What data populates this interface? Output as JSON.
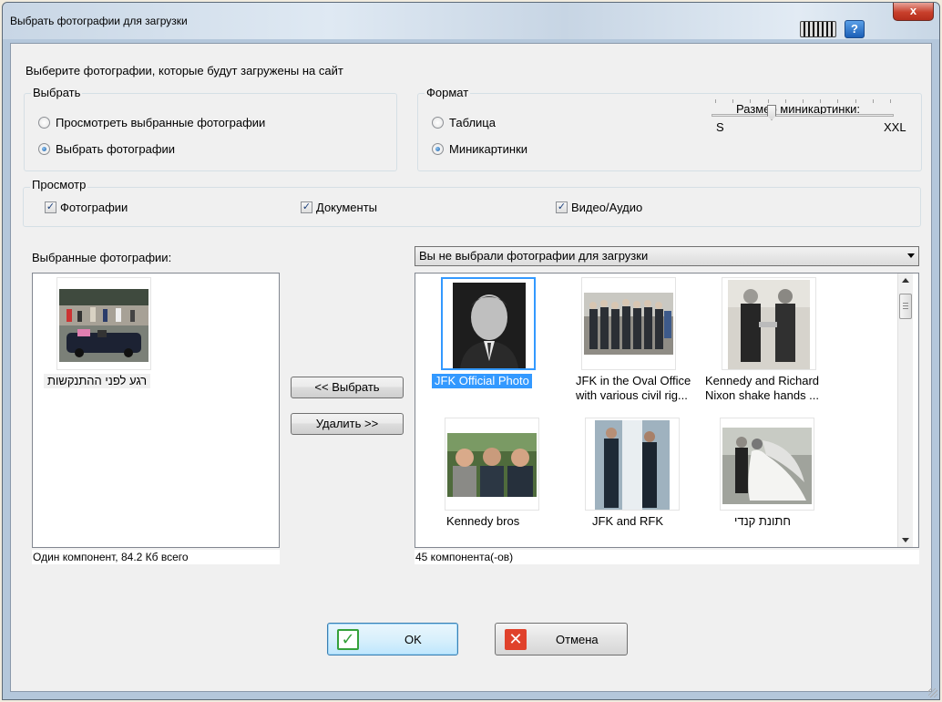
{
  "window": {
    "title": "Выбрать фотографии для загрузки",
    "help_label": "?",
    "close_label": "x"
  },
  "instructions": "Выберите фотографии, которые будут загружены на сайт",
  "select_group": {
    "legend": "Выбрать",
    "options": [
      "Просмотреть выбранные фотографии",
      "Выбрать фотографии"
    ],
    "selected_index": 1
  },
  "format_group": {
    "legend": "Формат",
    "options": [
      "Таблица",
      "Миникартинки"
    ],
    "selected_index": 1,
    "thumb_size_label": "Размер миникартинки:",
    "size_min": "S",
    "size_max": "XXL",
    "size_level": 0.33
  },
  "view_group": {
    "legend": "Просмотр",
    "items": [
      {
        "label": "Фотографии",
        "checked": true
      },
      {
        "label": "Документы",
        "checked": true
      },
      {
        "label": "Видео/Аудио",
        "checked": true
      }
    ]
  },
  "selected_panel": {
    "label": "Выбранные фотографии:",
    "items": [
      {
        "caption": "רגע לפני ההתנקשות"
      }
    ],
    "status": "Один компонент, 84.2 Кб всего"
  },
  "middle_buttons": {
    "add": "<< Выбрать",
    "remove": "Удалить >>"
  },
  "available_panel": {
    "dropdown_value": "Вы не выбрали фотографии для загрузки",
    "items": [
      {
        "caption_lines": [
          "JFK Official Photo"
        ],
        "selected": true
      },
      {
        "caption_lines": [
          "JFK in the Oval Office",
          "with various civil rig..."
        ],
        "selected": false
      },
      {
        "caption_lines": [
          "Kennedy and Richard",
          "Nixon shake hands ..."
        ],
        "selected": false
      },
      {
        "caption_lines": [
          "Kennedy bros"
        ],
        "selected": false
      },
      {
        "caption_lines": [
          "JFK and RFK"
        ],
        "selected": false
      },
      {
        "caption_lines": [
          "חתונת קנדי"
        ],
        "selected": false
      }
    ],
    "status": "45 компонента(-ов)"
  },
  "footer": {
    "ok_label": "OK",
    "cancel_label": "Отмена"
  },
  "colors": {
    "selection": "#3399ff",
    "ok_green": "#35a13a",
    "cancel_red": "#e0412b"
  }
}
